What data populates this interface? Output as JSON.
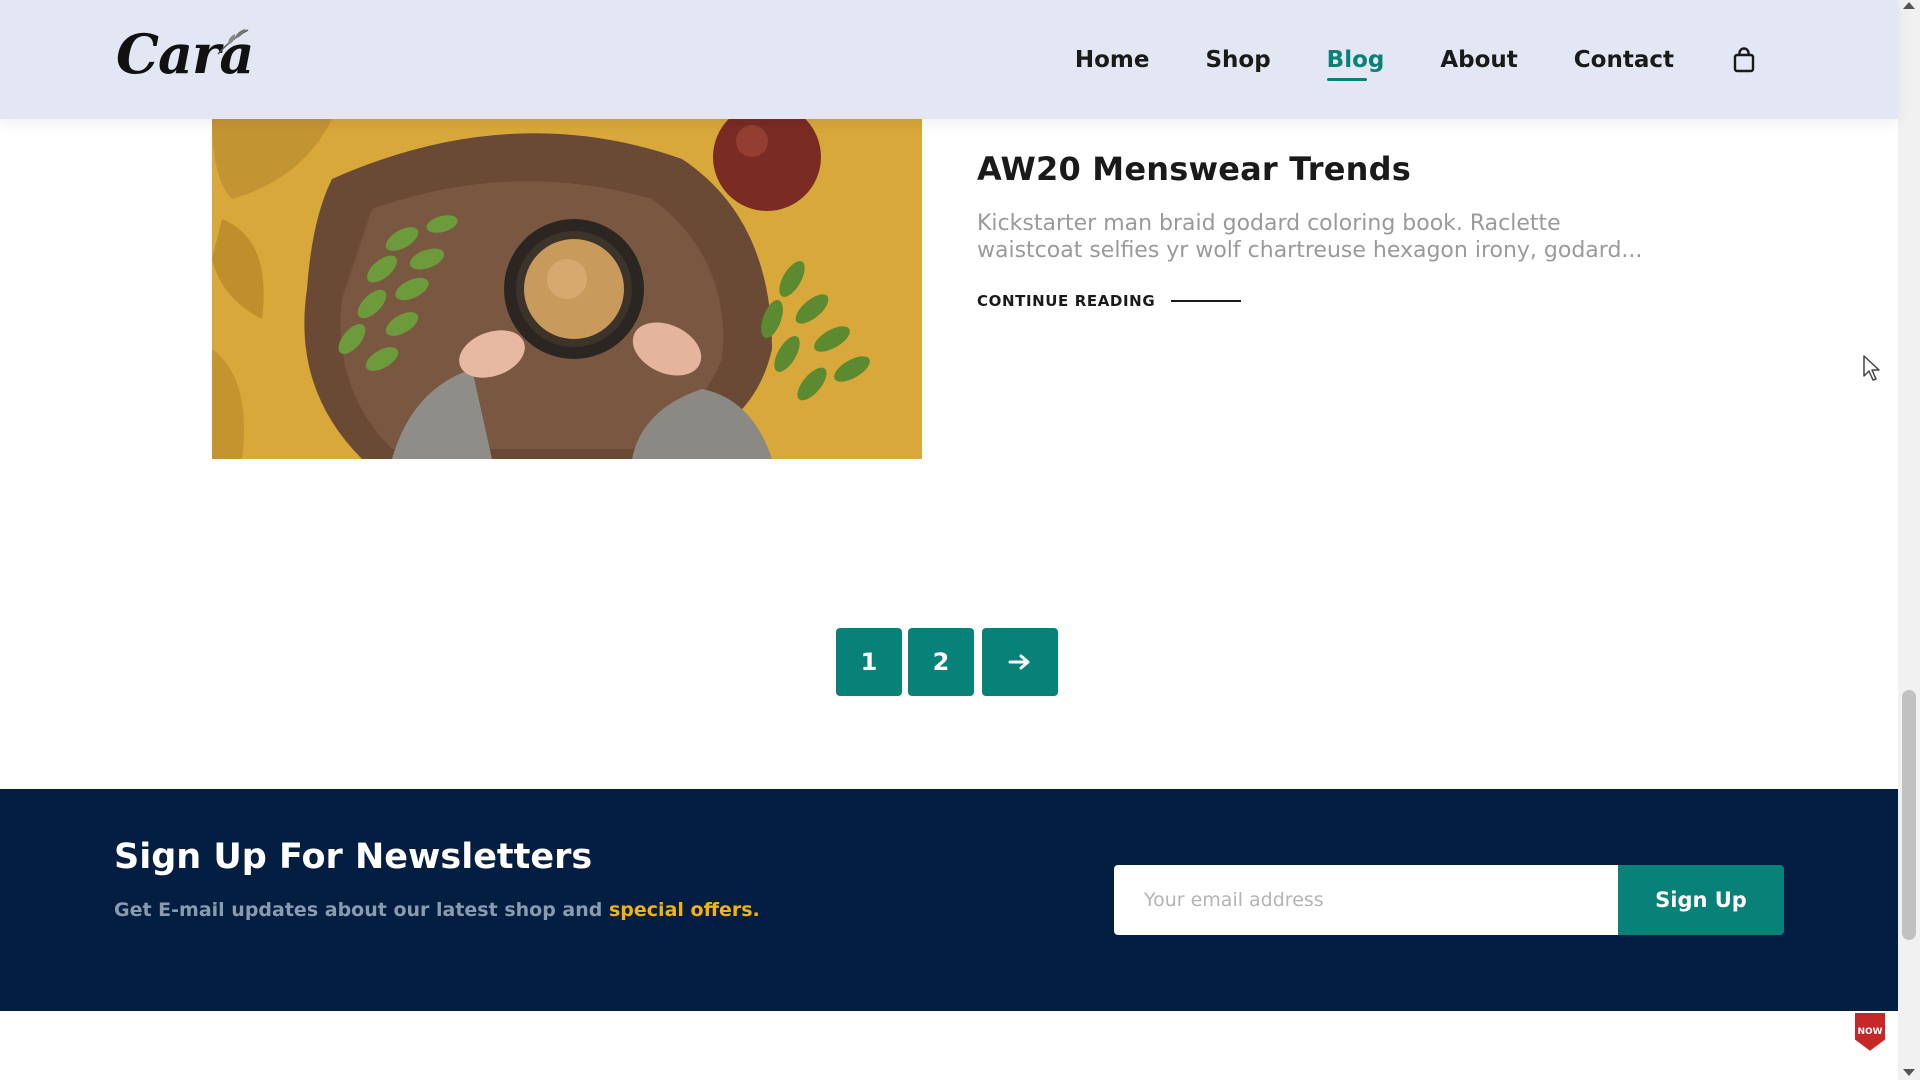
{
  "header": {
    "logo": "Cara",
    "nav": [
      {
        "label": "Home",
        "active": false
      },
      {
        "label": "Shop",
        "active": false
      },
      {
        "label": "Blog",
        "active": true
      },
      {
        "label": "About",
        "active": false
      },
      {
        "label": "Contact",
        "active": false
      }
    ],
    "cart_icon": "shopping-bag-icon"
  },
  "post": {
    "title": "AW20 Menswear Trends",
    "excerpt": "Kickstarter man braid godard coloring book. Raclette waistcoat selfies yr wolf chartreuse hexagon irony, godard...",
    "continue_label": "CONTINUE READING"
  },
  "pagination": {
    "pages": [
      "1",
      "2"
    ],
    "next_icon": "arrow-right-icon"
  },
  "newsletter": {
    "title": "Sign Up For Newsletters",
    "subtitle": "Get E-mail updates about our latest shop and",
    "subtitle_highlight": "special offers.",
    "email_placeholder": "Your email address",
    "button_label": "Sign Up"
  },
  "badge": {
    "text": "NOW"
  },
  "colors": {
    "accent": "#088178",
    "header_bg": "#e3e6f3",
    "newsletter_bg": "#041e42",
    "highlight": "#f3b20d"
  }
}
